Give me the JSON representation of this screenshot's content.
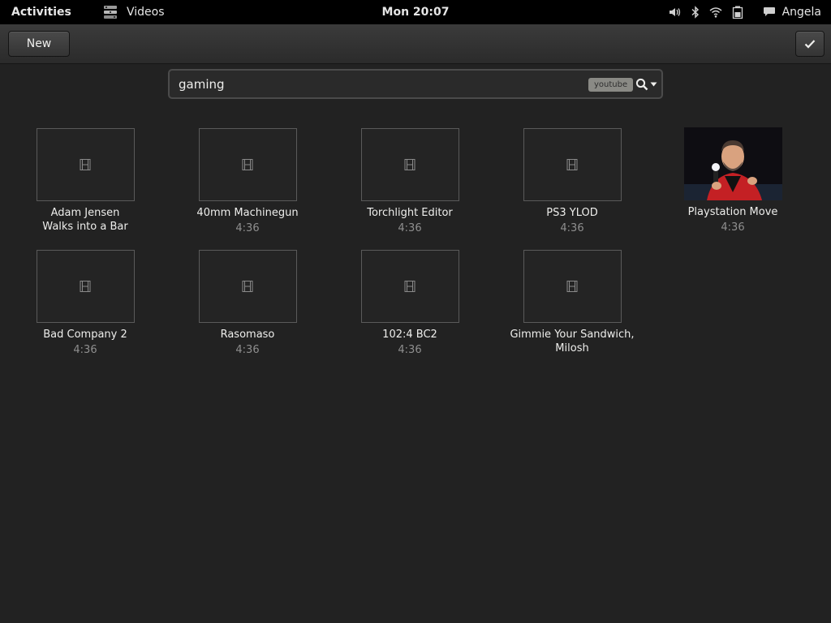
{
  "topbar": {
    "activities": "Activities",
    "app_icon": "film-reel-icon",
    "app_name": "Videos",
    "clock": "Mon 20:07",
    "status_icons": [
      "volume-icon",
      "bluetooth-icon",
      "wifi-icon",
      "battery-icon",
      "chat-bubble-icon"
    ],
    "user": "Angela"
  },
  "toolbar": {
    "new_label": "New",
    "select_icon": "checkmark-icon"
  },
  "search": {
    "query": "gaming",
    "source": "youtube",
    "icon": "search-dropdown-icon"
  },
  "videos": [
    {
      "title": "Adam Jensen Walks into a Bar",
      "duration": "",
      "thumbnail": "film-icon"
    },
    {
      "title": "40mm Machinegun",
      "duration": "4:36",
      "thumbnail": "film-icon"
    },
    {
      "title": "Torchlight Editor",
      "duration": "4:36",
      "thumbnail": "film-icon"
    },
    {
      "title": "PS3 YLOD",
      "duration": "4:36",
      "thumbnail": "film-icon"
    },
    {
      "title": "Playstation Move",
      "duration": "4:36",
      "thumbnail": "photo-man-with-motion-controller"
    },
    {
      "title": "Bad Company 2",
      "duration": "4:36",
      "thumbnail": "film-icon"
    },
    {
      "title": "Rasomaso",
      "duration": "4:36",
      "thumbnail": "film-icon"
    },
    {
      "title": "102:4 BC2",
      "duration": "4:36",
      "thumbnail": "film-icon"
    },
    {
      "title": "Gimmie Your Sandwich, Milosh",
      "duration": "",
      "thumbnail": "film-icon"
    }
  ],
  "colors": {
    "background": "#222222",
    "topbar": "#000000",
    "text": "#eeeeec",
    "muted": "#8f8f8f",
    "tag": "#8a8a85"
  }
}
